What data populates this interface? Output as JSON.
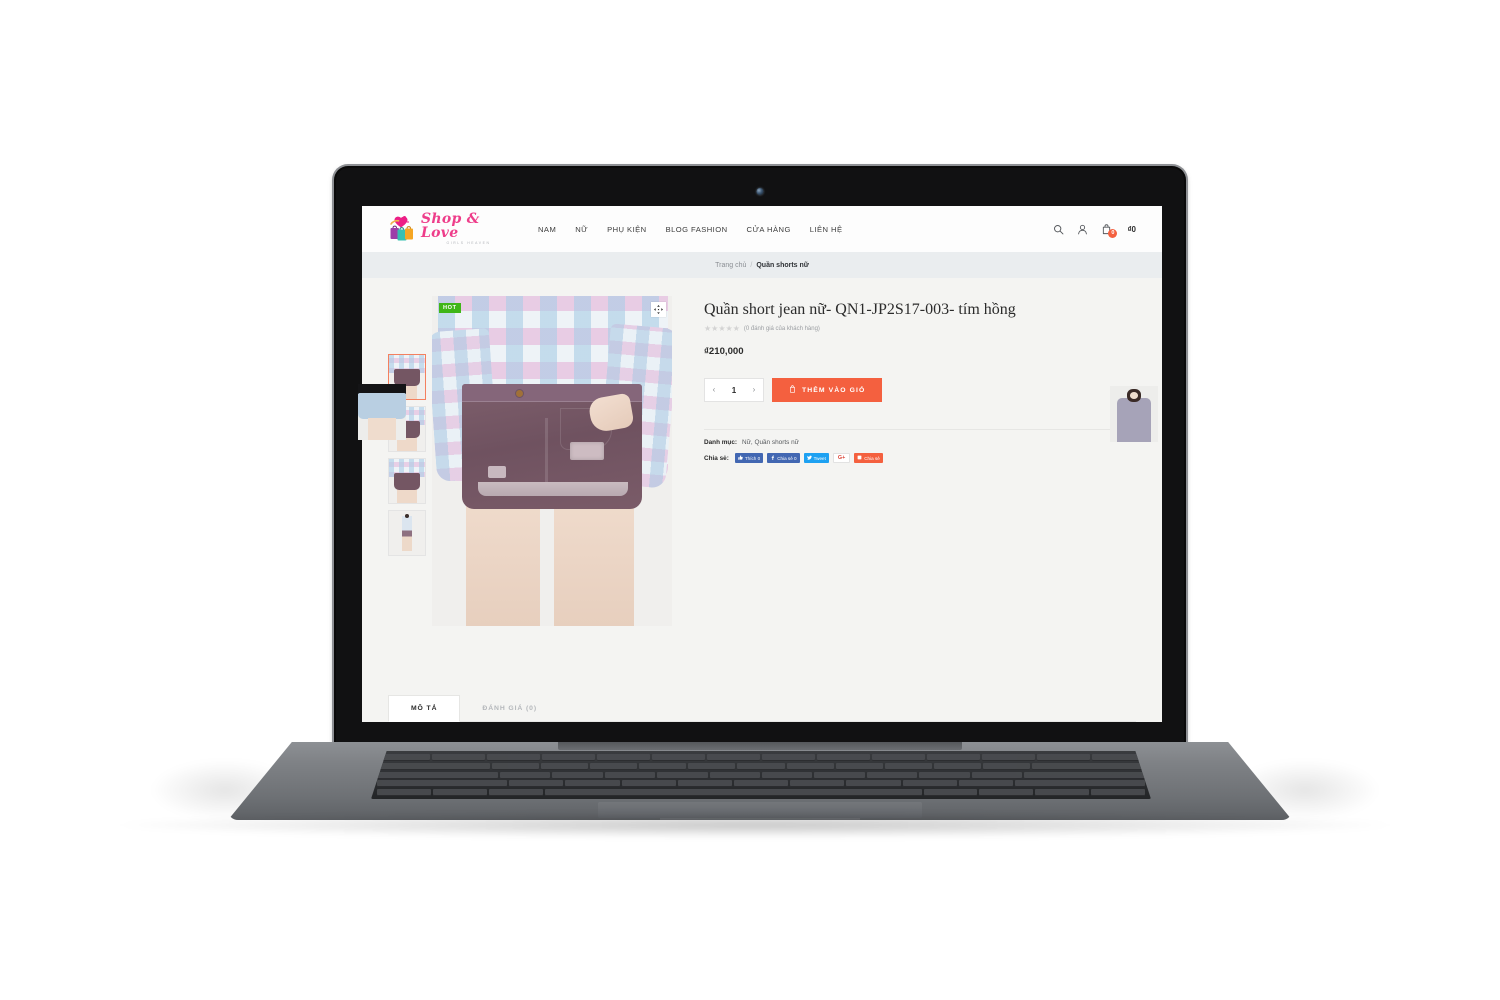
{
  "site": {
    "header": {
      "logo_name": "Shop & Love",
      "logo_sub": "GIRLS HEAVEN",
      "nav": [
        {
          "label": "NAM"
        },
        {
          "label": "NỮ"
        },
        {
          "label": "PHỤ KIỆN"
        },
        {
          "label": "BLOG FASHION"
        },
        {
          "label": "CỬA HÀNG"
        },
        {
          "label": "LIÊN HỆ"
        }
      ],
      "icons": {
        "search": "search-icon",
        "account": "user-icon",
        "cart": "cart-icon"
      },
      "cart_count": "0",
      "cart_amount": "₫0"
    },
    "breadcrumb": {
      "home": "Trang chủ",
      "separator": "/",
      "current": "Quần shorts nữ"
    },
    "gallery": {
      "badge": "HOT",
      "zoom_icon": "expand-move-icon",
      "thumbnails": [
        {
          "alt": "Quần short jean tím hồng - mặt trước"
        },
        {
          "alt": "Quần short jean tím hồng - góc nghiêng"
        },
        {
          "alt": "Quần short jean tím hồng - cận cảnh"
        },
        {
          "alt": "Người mẫu mặc quần short jean - toàn thân"
        }
      ],
      "selected_index": 0
    },
    "product": {
      "title": "Quần short jean nữ- QN1-JP2S17-003- tím hồng",
      "stars": "★★★★★",
      "star_count": 5,
      "rating_text": "(0 đánh giá của khách hàng)",
      "price": "₫210,000",
      "quantity": "1",
      "qty_decrease": "‹",
      "qty_increase": "›",
      "add_to_cart": "THÊM VÀO GIỎ",
      "category_label": "Danh mục:",
      "category_value": "Nữ, Quần shorts nữ",
      "share_label": "Chia sẻ:",
      "share_buttons": [
        {
          "name": "facebook-like",
          "label": "Thích 0"
        },
        {
          "name": "facebook-share",
          "label": "Chia sẻ 0"
        },
        {
          "name": "twitter-tweet",
          "label": "Tweet"
        },
        {
          "name": "google-plus",
          "label": "G+"
        },
        {
          "name": "zalo-share",
          "label": "Chia sẻ"
        }
      ]
    },
    "tabs": [
      {
        "label": "MÔ TẢ",
        "active": true
      },
      {
        "label": "ĐÁNH GIÁ (0)",
        "active": false
      }
    ]
  },
  "colors": {
    "accent": "#f4603f",
    "brand_pink": "#ee3d8a",
    "hot_badge": "#3fb618",
    "breadcrumb_bg": "#eaedef",
    "page_bg": "#f4f4f2",
    "facebook": "#4267b2",
    "twitter": "#1da1f2"
  }
}
